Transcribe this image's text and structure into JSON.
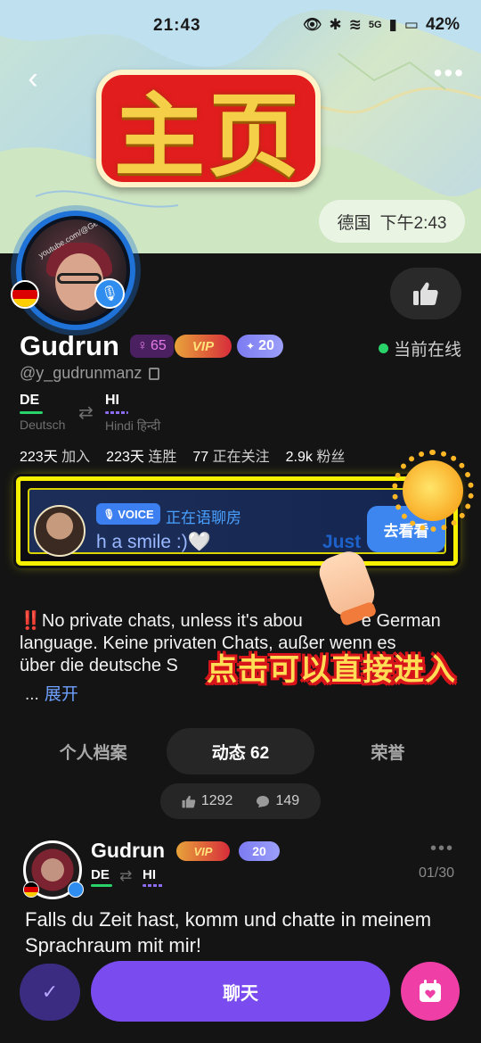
{
  "status_bar": {
    "time": "21:43",
    "signal_label": "5G",
    "battery": "42%"
  },
  "header": {
    "banner_title": "主页",
    "locale_country": "德国",
    "locale_time": "下午2:43"
  },
  "profile": {
    "name": "Gudrun",
    "gender_level": "65",
    "vip_label": "VIP",
    "level": "20",
    "online_status": "当前在线",
    "handle": "@y_gudrunmanz",
    "avatar_ring_text": "youtube.com/@GermanizeMe",
    "native_language": {
      "code": "DE",
      "name": "Deutsch"
    },
    "learning_language": {
      "code": "HI",
      "name": "Hindi हिन्दी"
    },
    "stats": [
      {
        "value": "223天",
        "label": "加入"
      },
      {
        "value": "223天",
        "label": "连胜"
      },
      {
        "value": "77",
        "label": "正在关注"
      },
      {
        "value": "2.9k",
        "label": "粉丝"
      }
    ]
  },
  "voice_room": {
    "tag": "VOICE",
    "status": "正在语聊房",
    "message": "h a smile :)",
    "message_emoji": "🤍",
    "message_next": "Just",
    "join_button": "去看看"
  },
  "bio": {
    "warning_mark": "‼️",
    "text_line1": "No private chats, unless it's abou",
    "text_line1_end": "e German",
    "text_line2": "language. Keine privaten Chats, außer wenn es",
    "text_line3": "über die deutsche S",
    "ellipsis": "...",
    "expand_label": "展开",
    "overlay_hint": "点击可以直接进入"
  },
  "tabs": [
    {
      "label": "个人档案"
    },
    {
      "label": "动态 62"
    },
    {
      "label": "荣誉"
    }
  ],
  "post_counts": {
    "likes": "1292",
    "comments": "149"
  },
  "post": {
    "author": "Gudrun",
    "vip_label": "VIP",
    "level": "20",
    "native_code": "DE",
    "learning_code": "HI",
    "page_indicator": "01/30",
    "text": "Falls du Zeit hast, komm und chatte in meinem Sprachraum mit mir!"
  },
  "bottom_bar": {
    "chat_label": "聊天"
  },
  "colors": {
    "accent_purple": "#7a4cf0",
    "online_green": "#2ad36a",
    "vip_gold": "#ffe27a",
    "gift_pink": "#ef3fa6"
  }
}
